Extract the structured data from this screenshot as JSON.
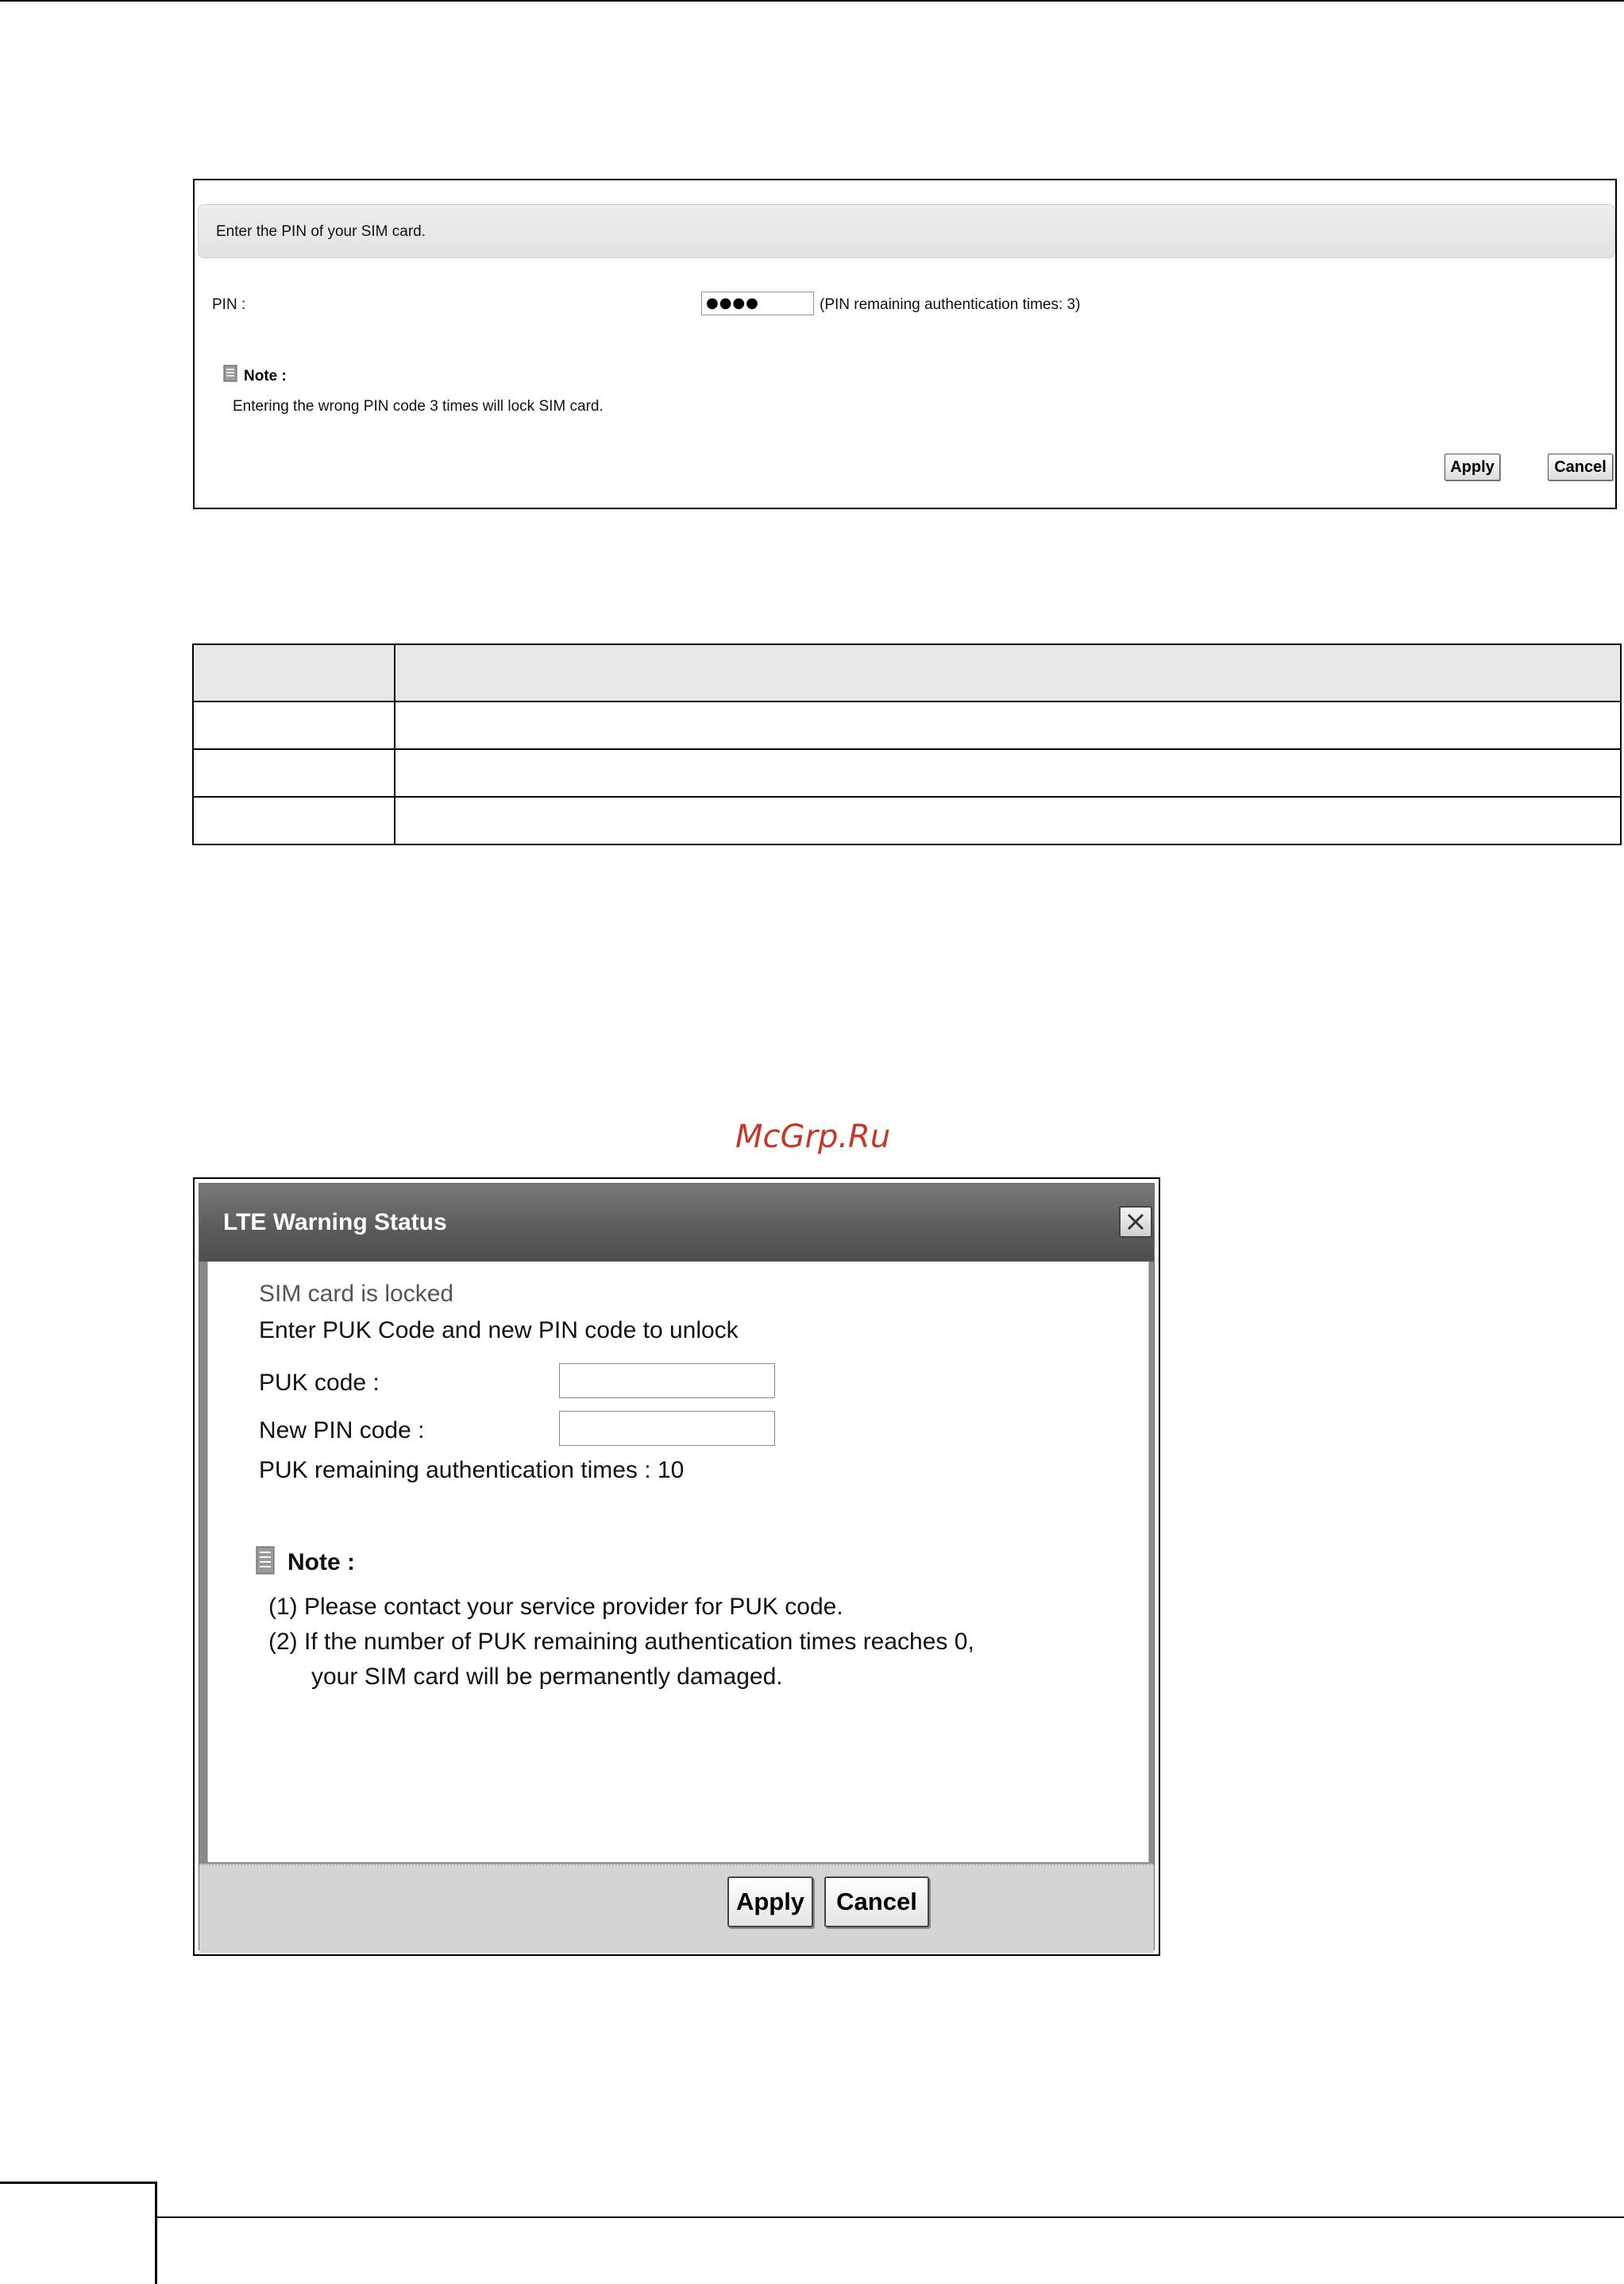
{
  "pin_screen": {
    "header_text": "Enter the PIN of your SIM card.",
    "pin_label": "PIN :",
    "pin_value_masked": "●●●●",
    "pin_remaining_text": "(PIN remaining authentication times: 3)",
    "note_title": "Note :",
    "note_text": "Entering the wrong PIN code 3 times will lock SIM card.",
    "apply_label": "Apply",
    "cancel_label": "Cancel",
    "note_icon": "document-icon"
  },
  "table": {
    "header_cells": [
      "",
      ""
    ],
    "row_count": 3
  },
  "watermark": "McGrp.Ru",
  "lte_dialog": {
    "title": "LTE Warning Status",
    "close_icon": "close-icon",
    "status_text": "SIM card is locked",
    "instruction": "Enter PUK Code and new PIN code to unlock",
    "puk_label": "PUK code :",
    "puk_value": "",
    "new_pin_label": "New PIN code :",
    "new_pin_value": "",
    "puk_remaining_text": "PUK remaining authentication times : 10",
    "note_title": "Note :",
    "note_line1": "(1) Please contact your service provider for PUK code.",
    "note_line2": "(2) If the number of PUK remaining authentication times reaches 0,",
    "note_line3": "your SIM card will be permanently damaged.",
    "apply_label": "Apply",
    "cancel_label": "Cancel"
  },
  "colors": {
    "title_bar": "#5a5a5a",
    "footer_bar": "#d4d4d4",
    "watermark": "#c0392b"
  }
}
